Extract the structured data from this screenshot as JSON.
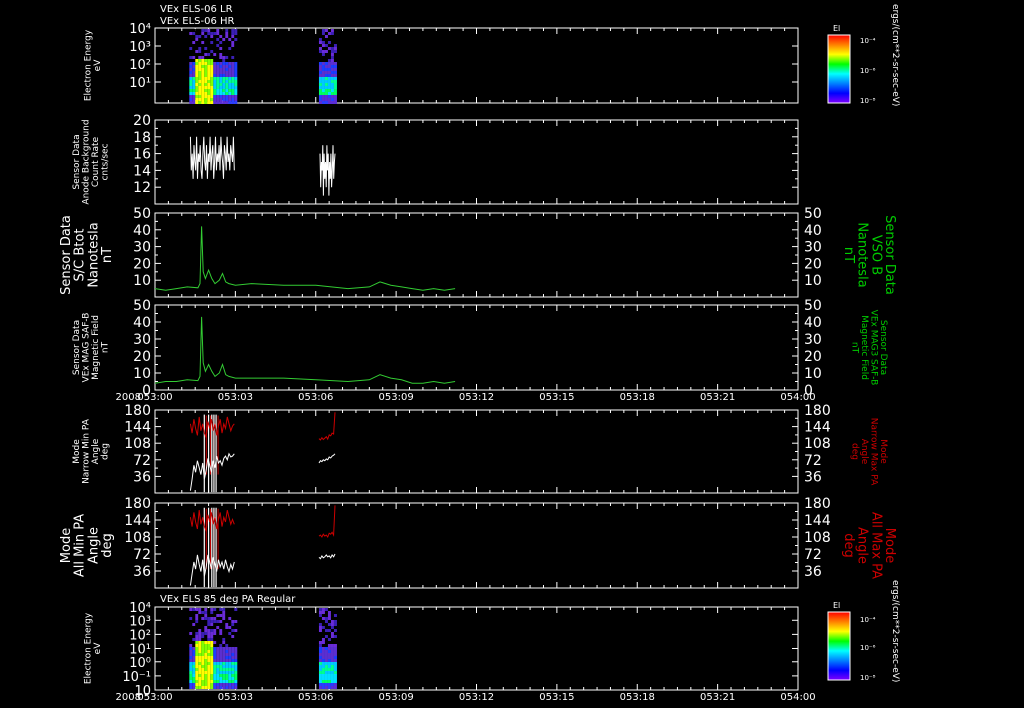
{
  "header": {
    "title_line1": "VEx ELS-06 LR",
    "title_line2": "VEx ELS-06 HR"
  },
  "colorbar": {
    "title": "El",
    "units": "ergs/(cm**2-sr-sec-eV)",
    "top_label": "10⁻⁴",
    "mid_label": "10⁻⁶",
    "bottom_label": "10⁻⁸",
    "colors": [
      "#ff0000",
      "#ff8000",
      "#ffff00",
      "#00ff00",
      "#00ffff",
      "#0080ff",
      "#0000ff",
      "#8000ff"
    ]
  },
  "colors": {
    "frame": "#ffffff",
    "white_trace": "#ffffff",
    "green_trace": "#33cc33",
    "red_trace": "#cc0000",
    "right_label_green": "#00cc00",
    "right_label_red": "#cc0000"
  },
  "time_axis": {
    "start_minute": 0,
    "end_minute": 60,
    "ticks": [
      "053:00",
      "053:03",
      "053:06",
      "053:09",
      "053:12",
      "053:15",
      "053:18",
      "053:21",
      "054:00"
    ],
    "year": "2008"
  },
  "chart_data": [
    {
      "id": "spec1",
      "type": "heatmap",
      "ylabel": "Electron Energy\neV",
      "y_log": true,
      "yticks": [
        {
          "label": "10⁴",
          "pos": 1.0
        },
        {
          "label": "10³",
          "pos": 0.76
        },
        {
          "label": "10²",
          "pos": 0.52
        },
        {
          "label": "10¹",
          "pos": 0.28
        }
      ],
      "intervals": [
        [
          3.2,
          7.4
        ],
        [
          15.3,
          16.8
        ]
      ],
      "spike_minute": 4.5
    },
    {
      "id": "background",
      "type": "line",
      "ylabel": "Sensor Data\nAnode Background\nCount Rate\ncnts/sec",
      "ylim": [
        10,
        20
      ],
      "yticks": [
        12,
        14,
        16,
        18,
        20
      ],
      "series": [
        {
          "color": "white",
          "segments": [
            {
              "x_start": 3.3,
              "x_end": 7.4,
              "values": [
                18,
                14,
                16,
                13,
                17,
                15,
                14,
                18,
                13,
                16,
                15,
                17,
                14,
                13,
                16,
                18,
                15,
                14,
                17,
                13,
                16,
                15,
                18,
                14,
                16,
                17,
                13,
                15,
                18,
                14,
                16,
                15,
                17,
                14,
                18,
                16,
                15,
                13,
                17,
                16,
                14,
                18,
                15,
                16,
                14,
                17,
                16,
                15,
                18,
                14
              ]
            },
            {
              "x_start": 15.4,
              "x_end": 16.8,
              "values": [
                16,
                12,
                15,
                14,
                17,
                11,
                16,
                13,
                15,
                12,
                17,
                14,
                16,
                11,
                15,
                13,
                16,
                12,
                14,
                17,
                13,
                15,
                16
              ]
            }
          ]
        }
      ]
    },
    {
      "id": "vso_b",
      "type": "line",
      "ylabel": "Sensor Data\nS/C Btot\nNanotesla\nnT",
      "right_label": "Sensor Data\nVSO B\nNanotesla\nnT",
      "ylim": [
        0,
        50
      ],
      "yticks": [
        10,
        20,
        30,
        40,
        50
      ],
      "series": [
        {
          "color": "green",
          "points": [
            [
              0,
              5
            ],
            [
              1,
              4
            ],
            [
              2,
              5
            ],
            [
              3,
              6
            ],
            [
              4,
              5.5
            ],
            [
              4.2,
              8
            ],
            [
              4.35,
              42
            ],
            [
              4.5,
              15
            ],
            [
              4.7,
              11
            ],
            [
              5.0,
              16
            ],
            [
              5.3,
              11
            ],
            [
              5.6,
              8
            ],
            [
              6.0,
              10
            ],
            [
              6.3,
              14
            ],
            [
              6.6,
              9
            ],
            [
              6.9,
              8
            ],
            [
              7.5,
              7
            ],
            [
              9,
              8
            ],
            [
              12,
              7
            ],
            [
              15,
              7
            ],
            [
              18,
              5
            ],
            [
              20,
              6
            ],
            [
              21,
              9
            ],
            [
              22,
              7
            ],
            [
              23,
              6
            ],
            [
              24,
              5
            ],
            [
              25,
              4
            ],
            [
              26,
              5
            ],
            [
              27,
              4
            ],
            [
              28,
              5
            ]
          ]
        }
      ]
    },
    {
      "id": "mag",
      "type": "line",
      "ylabel": "Sensor Data\nVEx MAG SAF-B\nMagnetic Field\nnT",
      "right_label": "Sensor Data\nVEx MAG3 SAF-B\nMagnetic Field\nnT",
      "ylim": [
        0,
        50
      ],
      "yticks": [
        0,
        10,
        20,
        30,
        40,
        50
      ],
      "series": [
        {
          "color": "green",
          "points": [
            [
              0,
              4
            ],
            [
              1,
              5
            ],
            [
              2,
              5
            ],
            [
              3,
              6
            ],
            [
              4,
              5.5
            ],
            [
              4.2,
              8
            ],
            [
              4.35,
              43
            ],
            [
              4.5,
              16
            ],
            [
              4.7,
              11
            ],
            [
              5.0,
              15
            ],
            [
              5.3,
              11
            ],
            [
              5.6,
              8
            ],
            [
              6.0,
              10
            ],
            [
              6.3,
              15
            ],
            [
              6.6,
              9
            ],
            [
              6.9,
              8
            ],
            [
              7.5,
              7
            ],
            [
              9,
              7
            ],
            [
              12,
              7
            ],
            [
              15,
              6
            ],
            [
              18,
              5
            ],
            [
              20,
              6
            ],
            [
              21,
              9
            ],
            [
              22,
              7
            ],
            [
              23,
              6
            ],
            [
              24,
              4
            ],
            [
              25,
              4
            ],
            [
              26,
              5
            ],
            [
              27,
              4
            ],
            [
              28,
              5
            ]
          ]
        }
      ]
    },
    {
      "id": "narrow_pa",
      "type": "line",
      "ylabel": "Mode\nNarrow Min PA\nAngle\ndeg",
      "right_label": "Mode\nNarrow Max PA\nAngle\ndeg",
      "ylim": [
        0,
        180
      ],
      "yticks": [
        36,
        72,
        108,
        144,
        180
      ],
      "series": [
        {
          "color": "red",
          "segments": [
            {
              "x_start": 3.3,
              "x_end": 7.4,
              "values": [
                150,
                130,
                160,
                140,
                125,
                165,
                135,
                150,
                130,
                120,
                155,
                140,
                160,
                135,
                150,
                125,
                145,
                160,
                130,
                150,
                140,
                165,
                150,
                135,
                145,
                150
              ]
            },
            {
              "x_start": 15.3,
              "x_end": 16.8,
              "values": [
                118,
                115,
                120,
                116,
                119,
                122,
                117,
                126,
                124,
                130,
                128,
                175
              ]
            }
          ]
        },
        {
          "color": "white",
          "segments": [
            {
              "x_start": 3.3,
              "x_end": 7.4,
              "values": [
                5,
                30,
                60,
                45,
                70,
                55,
                40,
                65,
                30,
                50,
                75,
                60,
                45,
                70,
                55,
                80,
                65,
                70,
                60,
                75,
                80,
                72,
                85,
                78,
                80,
                85
              ]
            },
            {
              "x_start": 15.3,
              "x_end": 16.8,
              "values": [
                65,
                70,
                68,
                72,
                70,
                74,
                72,
                78,
                76,
                80,
                82,
                85
              ]
            }
          ]
        }
      ],
      "spikes": [
        4.6,
        5.0,
        5.3,
        5.5,
        5.7
      ]
    },
    {
      "id": "all_pa",
      "type": "line",
      "ylabel": "Mode\nAll Min PA\nAngle\ndeg",
      "right_label": "Mode\nAll Max PA\nAngle\ndeg",
      "ylim": [
        0,
        180
      ],
      "yticks": [
        36,
        72,
        108,
        144,
        180
      ],
      "series": [
        {
          "color": "red",
          "segments": [
            {
              "x_start": 3.3,
              "x_end": 7.4,
              "values": [
                150,
                130,
                160,
                140,
                125,
                165,
                135,
                150,
                130,
                120,
                155,
                140,
                160,
                135,
                150,
                125,
                145,
                160,
                130,
                150,
                140,
                165,
                150,
                135,
                145,
                135
              ]
            },
            {
              "x_start": 15.3,
              "x_end": 16.8,
              "values": [
                110,
                112,
                108,
                114,
                110,
                112,
                108,
                116,
                114,
                118,
                112,
                175
              ]
            }
          ]
        },
        {
          "color": "white",
          "segments": [
            {
              "x_start": 3.3,
              "x_end": 7.4,
              "values": [
                5,
                30,
                55,
                40,
                70,
                50,
                35,
                60,
                25,
                45,
                70,
                55,
                40,
                65,
                50,
                35,
                60,
                45,
                55,
                40,
                60,
                45,
                35,
                50,
                40,
                55
              ]
            },
            {
              "x_start": 15.3,
              "x_end": 16.8,
              "values": [
                65,
                62,
                68,
                64,
                66,
                70,
                66,
                68,
                64,
                70,
                66,
                72
              ]
            }
          ]
        }
      ],
      "spikes": [
        4.6,
        5.0,
        5.3,
        5.5,
        5.7
      ]
    },
    {
      "id": "spec2",
      "type": "heatmap",
      "title": "VEx ELS 85 deg PA Regular",
      "ylabel": "Electron Energy\neV",
      "y_log": true,
      "yticks": [
        {
          "label": "10⁴",
          "pos": 1.0
        },
        {
          "label": "10³",
          "pos": 0.84
        },
        {
          "label": "10²",
          "pos": 0.67
        },
        {
          "label": "10¹",
          "pos": 0.5
        },
        {
          "label": "10⁰",
          "pos": 0.34
        },
        {
          "label": "10⁻¹",
          "pos": 0.17
        },
        {
          "label": "10",
          "pos": 0.0
        }
      ],
      "intervals": [
        [
          3.2,
          7.4
        ],
        [
          15.3,
          16.8
        ]
      ],
      "spike_minute": 4.5
    }
  ]
}
